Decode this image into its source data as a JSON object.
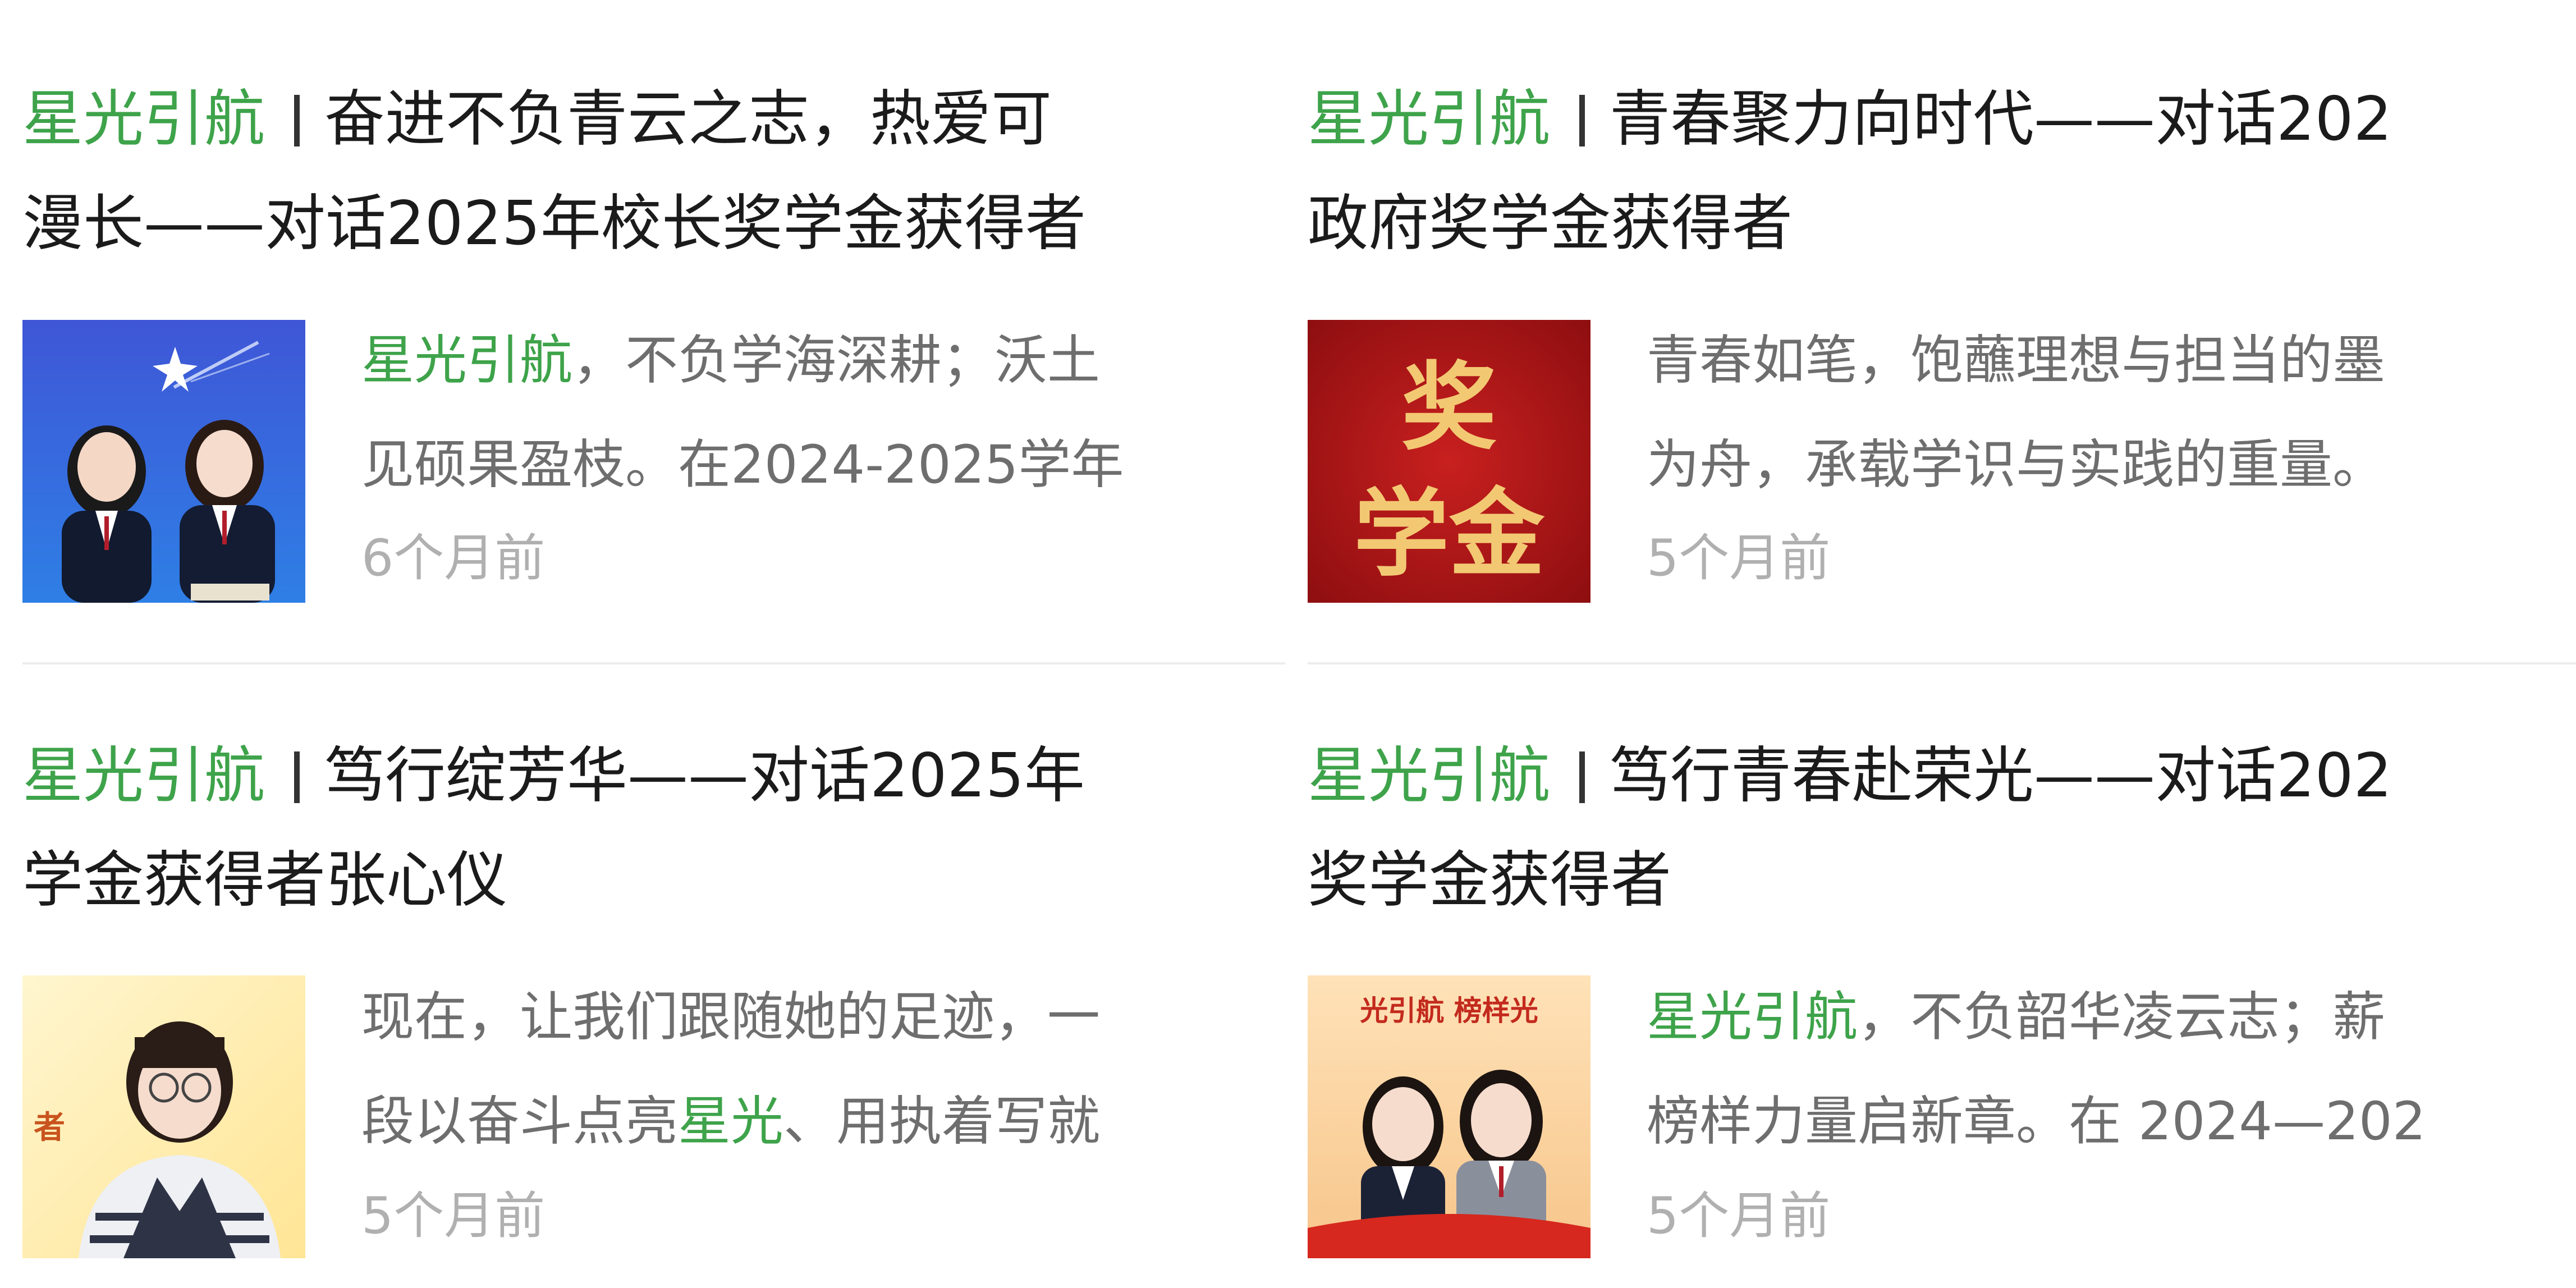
{
  "feed": {
    "articles": [
      {
        "tag": "星光引航",
        "title_line1": "奋进不负青云之志，热爱可",
        "title_line2": "漫长——对话2025年校长奖学金获得者",
        "summary_line1_highlight": "星光引航",
        "summary_line1_rest": "，不负学海深耕；沃土",
        "summary_line2": "见硕果盈枝。在2024-2025学年",
        "time": "6个月前"
      },
      {
        "tag": "星光引航",
        "title_line1": "青春聚力向时代——对话202",
        "title_line2": "政府奖学金获得者",
        "summary_line1": "青春如笔，饱蘸理想与担当的墨",
        "summary_line2": "为舟，承载学识与实践的重量。",
        "time": "5个月前",
        "thumb_text_top": "奖",
        "thumb_text_bottom": "学金"
      },
      {
        "tag": "星光引航",
        "title_line1": "笃行绽芳华——对话2025年",
        "title_line2": "学金获得者张心仪",
        "summary_line1": "现在，让我们跟随她的足迹，一",
        "summary_line2_pre": "段以奋斗点亮",
        "summary_line2_highlight": "星光",
        "summary_line2_post": "、用执着写就",
        "time": "5个月前",
        "thumb_side_text": "者"
      },
      {
        "tag": "星光引航",
        "title_line1": "笃行青春赴荣光——对话202",
        "title_line2": "奖学金获得者",
        "summary_line1_highlight": "星光引航",
        "summary_line1_rest": "，不负韶华凌云志；薪",
        "summary_line2": "榜样力量启新章。在 2024—202",
        "time": "5个月前",
        "thumb_banner": "光引航 榜样光"
      }
    ]
  },
  "colors": {
    "accent_green": "#3ea34a",
    "title_text": "#1b1b1b",
    "body_text": "#6e6e6e",
    "time_text": "#b0b0b0",
    "divider": "#ececec"
  }
}
